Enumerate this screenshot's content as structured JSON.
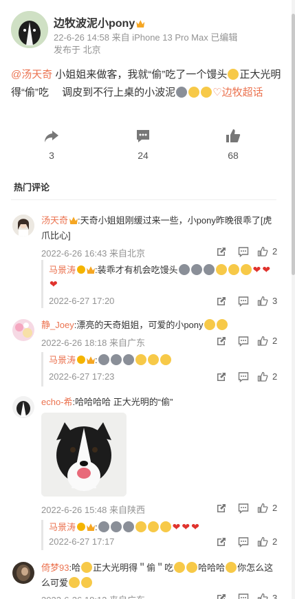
{
  "author": {
    "name": "边牧波泥小pony",
    "meta_line1": "22-6-26 14:58 来自 iPhone 13 Pro Max 已编辑",
    "meta_line2": "发布于 北京"
  },
  "post": {
    "mention": "@汤天奇",
    "text1": " 小姐姐来做客，我就“偷”吃了一个馒头",
    "text2": "正大光明得“偷”吃　 调皮到不行上桌的小波泥",
    "topic": "边牧超话"
  },
  "actions": {
    "repost_count": "3",
    "comment_count": "24",
    "like_count": "68"
  },
  "section": {
    "hot_comments": "热门评论"
  },
  "comments": [
    {
      "name": "汤天奇",
      "text": ":天奇小姐姐刚缓过来一些，小pony昨晚很乖了[虎爪比心]",
      "time": "2022-6-26 16:43 来自北京",
      "likes": "2",
      "reply": {
        "name": "马景涛",
        "text": ":装乖才有机会吃馒头",
        "time": "2022-6-27 17:20",
        "likes": "3"
      }
    },
    {
      "name": "静_Joey",
      "text": ":漂亮的天奇姐姐，可爱的小pony",
      "time": "2022-6-26 18:18 来自广东",
      "likes": "2",
      "reply": {
        "name": "马景涛",
        "text": ":",
        "time": "2022-6-27 17:23",
        "likes": "2"
      }
    },
    {
      "name": "echo-希",
      "text": ":哈哈哈哈 正大光明的“偷”",
      "time": "2022-6-26 15:48 来自陕西",
      "likes": "2",
      "reply": {
        "name": "马景涛",
        "text": ":",
        "time": "2022-6-27 17:17",
        "likes": "2"
      }
    },
    {
      "name": "倚梦93",
      "text1": ":哈",
      "text2": "正大光明得＂偷＂吃",
      "text3": "哈哈哈",
      "text4": "你怎么这么可爱",
      "time": "2022-6-26 18:12 来自广东",
      "likes": "3"
    }
  ]
}
